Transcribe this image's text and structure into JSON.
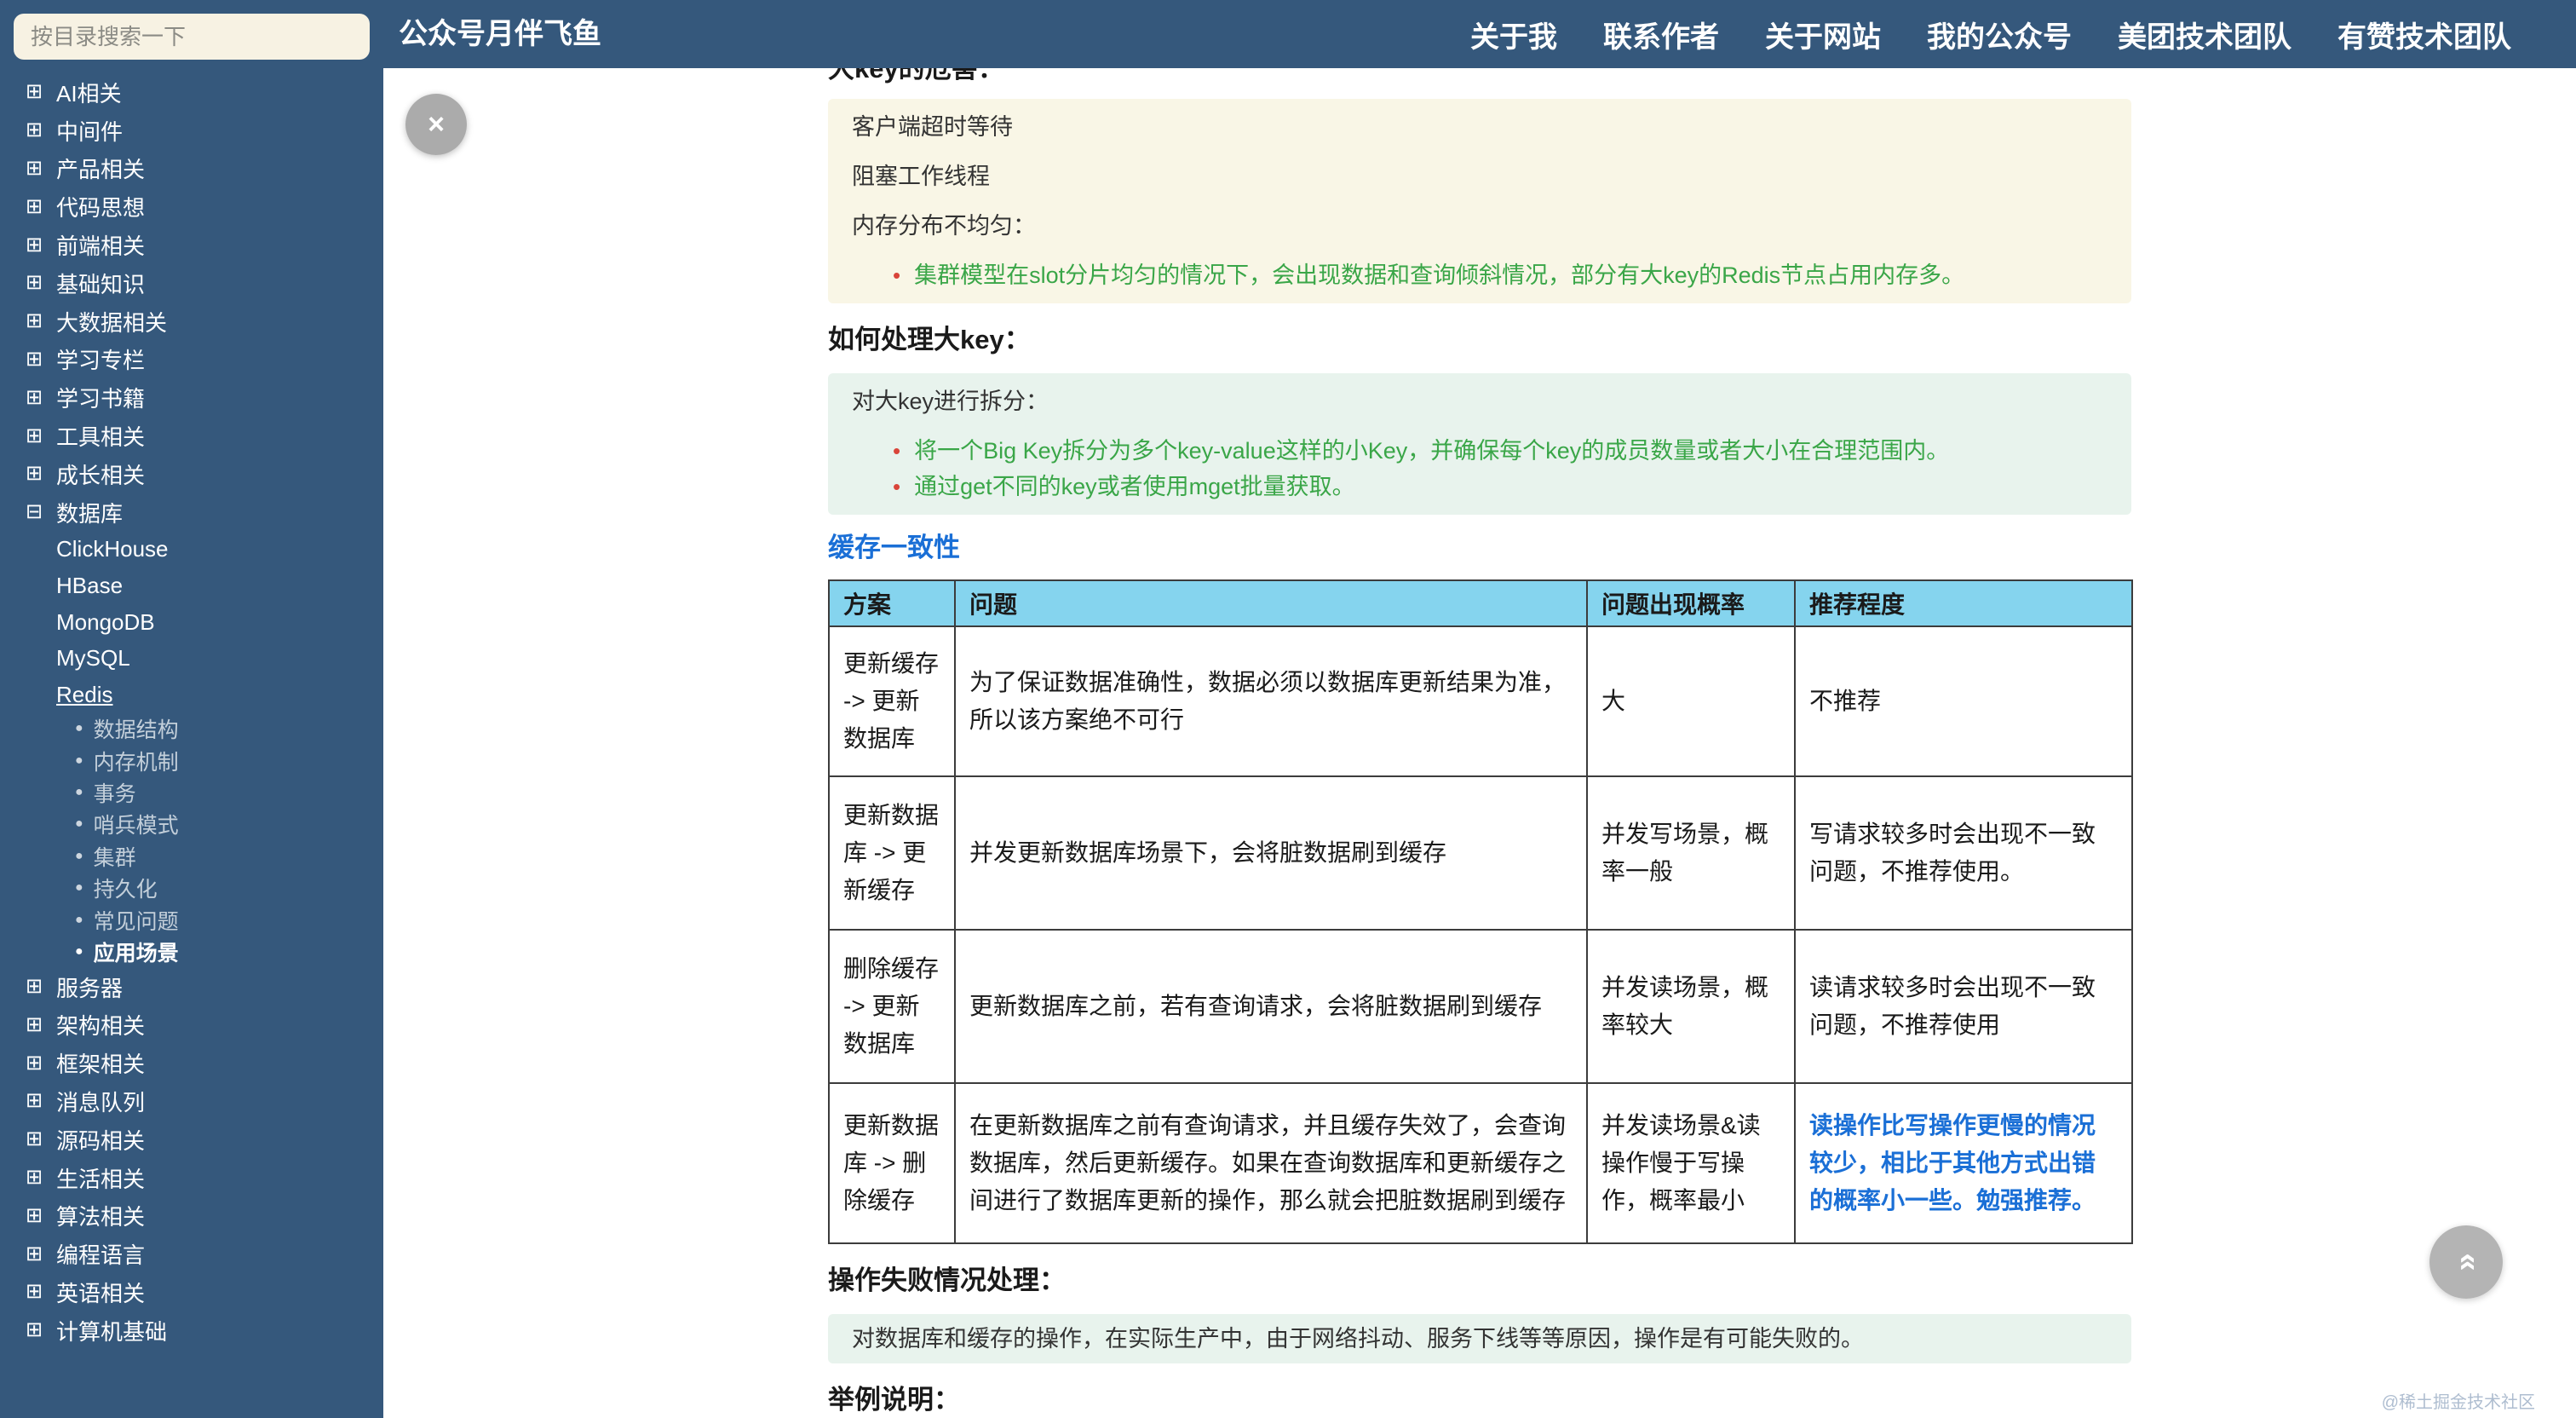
{
  "colors": {
    "chrome_bg": "#35587c",
    "table_header_bg": "#85d4ee",
    "green_text": "#3aa648",
    "bullet_red": "#d9453a",
    "link_blue": "#1a6fd6",
    "quote_cream": "#f9f6e6",
    "quote_mint": "#e8f3ed"
  },
  "header": {
    "title": "公众号月伴飞鱼",
    "nav": [
      "关于我",
      "联系作者",
      "关于网站",
      "我的公众号",
      "美团技术团队",
      "有赞技术团队"
    ]
  },
  "sidebar": {
    "search_placeholder": "按目录搜索一下",
    "collapsed_glyph": "⊞",
    "expanded_glyph": "⊟",
    "leaf_bullet": "●",
    "groups_top": [
      "AI相关",
      "中间件",
      "产品相关",
      "代码思想",
      "前端相关",
      "基础知识",
      "大数据相关",
      "学习专栏",
      "学习书籍",
      "工具相关",
      "成长相关"
    ],
    "db_group": "数据库",
    "db_children": [
      "ClickHouse",
      "HBase",
      "MongoDB",
      "MySQL",
      "Redis"
    ],
    "redis_leaves": [
      "数据结构",
      "内存机制",
      "事务",
      "哨兵模式",
      "集群",
      "持久化",
      "常见问题",
      "应用场景"
    ],
    "groups_bottom": [
      "服务器",
      "架构相关",
      "框架相关",
      "消息队列",
      "源码相关",
      "生活相关",
      "算法相关",
      "编程语言",
      "英语相关",
      "计算机基础"
    ]
  },
  "content": {
    "bullet_glyph": "•",
    "clipped_heading": "大key的危害：",
    "quote1_line1": "客户端超时等待",
    "quote1_line2": "阻塞工作线程",
    "quote1_line3": "内存分布不均匀：",
    "quote1_bullet1": "集群模型在slot分片均匀的情况下，会出现数据和查询倾斜情况，部分有大key的Redis节点占用内存多。",
    "heading_handle": "如何处理大key：",
    "quote2_line1": "对大key进行拆分：",
    "quote2_bullet1": "将一个Big Key拆分为多个key-value这样的小Key，并确保每个key的成员数量或者大小在合理范围内。",
    "quote2_bullet2": "通过get不同的key或者使用mget批量获取。",
    "cache_link": "缓存一致性",
    "table": {
      "headers": [
        "方案",
        "问题",
        "问题出现概率",
        "推荐程度"
      ],
      "r1c1": "更新缓存 -> 更新数据库",
      "r1c2": "为了保证数据准确性，数据必须以数据库更新结果为准，所以该方案绝不可行",
      "r1c3": "大",
      "r1c4": "不推荐",
      "r2c1": "更新数据库 -> 更新缓存",
      "r2c2": "并发更新数据库场景下，会将脏数据刷到缓存",
      "r2c3": "并发写场景，概率一般",
      "r2c4": "写请求较多时会出现不一致问题，不推荐使用。",
      "r3c1": "删除缓存 -> 更新数据库",
      "r3c2": "更新数据库之前，若有查询请求，会将脏数据刷到缓存",
      "r3c3": "并发读场景，概率较大",
      "r3c4": "读请求较多时会出现不一致问题，不推荐使用",
      "r4c1": "更新数据库 -> 删除缓存",
      "r4c2": "在更新数据库之前有查询请求，并且缓存失效了，会查询数据库，然后更新缓存。如果在查询数据库和更新缓存之间进行了数据库更新的操作，那么就会把脏数据刷到缓存",
      "r4c3": "并发读场景&读操作慢于写操作，概率最小",
      "r4c4": "读操作比写操作更慢的情况较少，相比于其他方式出错的概率小一些。勉强推荐。"
    },
    "heading_fail": "操作失败情况处理：",
    "quote3_line1": "对数据库和缓存的操作，在实际生产中，由于网络抖动、服务下线等等原因，操作是有可能失败的。",
    "heading_example": "举例说明："
  },
  "floating": {
    "close_glyph": "×",
    "backtop_glyph": "»"
  },
  "watermark": "@稀土掘金技术社区"
}
